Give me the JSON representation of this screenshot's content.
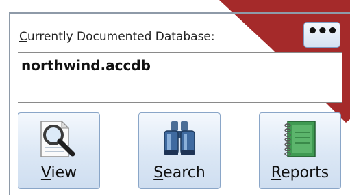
{
  "database": {
    "label_first_letter": "C",
    "label_rest": "urrently Documented Database:",
    "value": "northwind.accdb",
    "more_button_label": "•••"
  },
  "buttons": {
    "view": {
      "mnemonic": "V",
      "rest": "iew",
      "icon": "magnifier-document-icon"
    },
    "search": {
      "mnemonic": "S",
      "rest": "earch",
      "icon": "binoculars-icon"
    },
    "reports": {
      "mnemonic": "R",
      "rest": "eports",
      "icon": "notebook-icon"
    }
  },
  "colors": {
    "ribbon": "#a52a2a",
    "button_border": "#8aa6c8",
    "button_fill": "#dbe7f5"
  }
}
